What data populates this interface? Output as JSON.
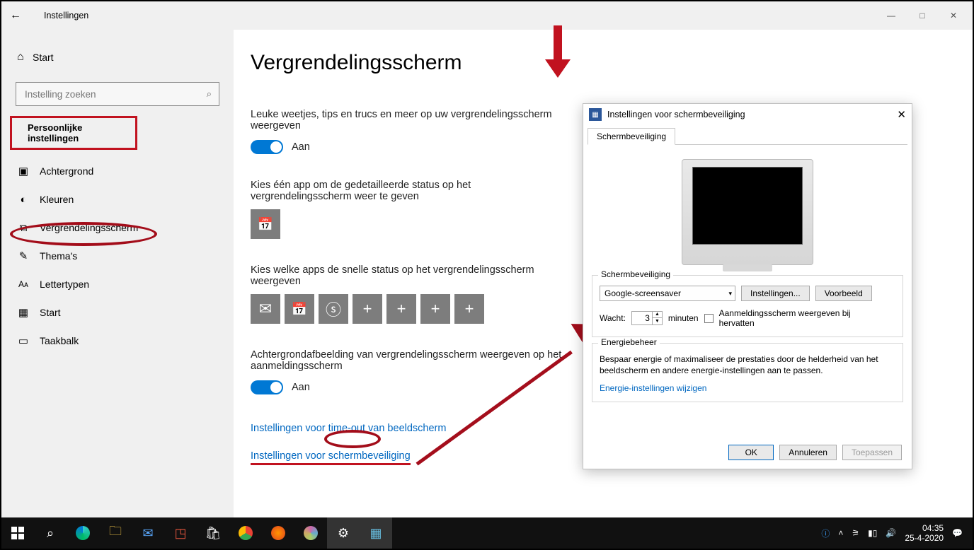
{
  "window": {
    "title": "Instellingen"
  },
  "sidebar": {
    "home": "Start",
    "search_placeholder": "Instelling zoeken",
    "group": "Persoonlijke instellingen",
    "items": [
      {
        "label": "Achtergrond"
      },
      {
        "label": "Kleuren"
      },
      {
        "label": "Vergrendelingsscherm",
        "selected": true
      },
      {
        "label": "Thema's"
      },
      {
        "label": "Lettertypen"
      },
      {
        "label": "Start"
      },
      {
        "label": "Taakbalk"
      }
    ]
  },
  "page": {
    "heading": "Vergrendelingsscherm",
    "fun_facts_label": "Leuke weetjes, tips en trucs en meer op uw vergrendelingsscherm weergeven",
    "toggle_on": "Aan",
    "detailed_status_label": "Kies één app om de gedetailleerde status op het vergrendelingsscherm weer te geven",
    "quick_status_label": "Kies welke apps de snelle status op het vergrendelingsscherm weergeven",
    "bg_on_signin_label": "Achtergrondafbeelding van vergrendelingsscherm weergeven op het aanmeldingsscherm",
    "link_timeout": "Instellingen voor time-out van beeldscherm",
    "link_screensaver": "Instellingen voor schermbeveiliging"
  },
  "dialog": {
    "title": "Instellingen voor schermbeveiliging",
    "tab": "Schermbeveiliging",
    "group_screensaver": "Schermbeveiliging",
    "screensaver_selected": "Google-screensaver",
    "btn_settings": "Instellingen...",
    "btn_preview": "Voorbeeld",
    "wait_label": "Wacht:",
    "wait_value": "3",
    "minutes": "minuten",
    "resume_label": "Aanmeldingsscherm weergeven bij hervatten",
    "group_power": "Energiebeheer",
    "power_text": "Bespaar energie of maximaliseer de prestaties door de helderheid van het beeldscherm en andere energie-instellingen aan te passen.",
    "power_link": "Energie-instellingen wijzigen",
    "ok": "OK",
    "cancel": "Annuleren",
    "apply": "Toepassen"
  },
  "taskbar": {
    "time": "04:35",
    "date": "25-4-2020"
  }
}
